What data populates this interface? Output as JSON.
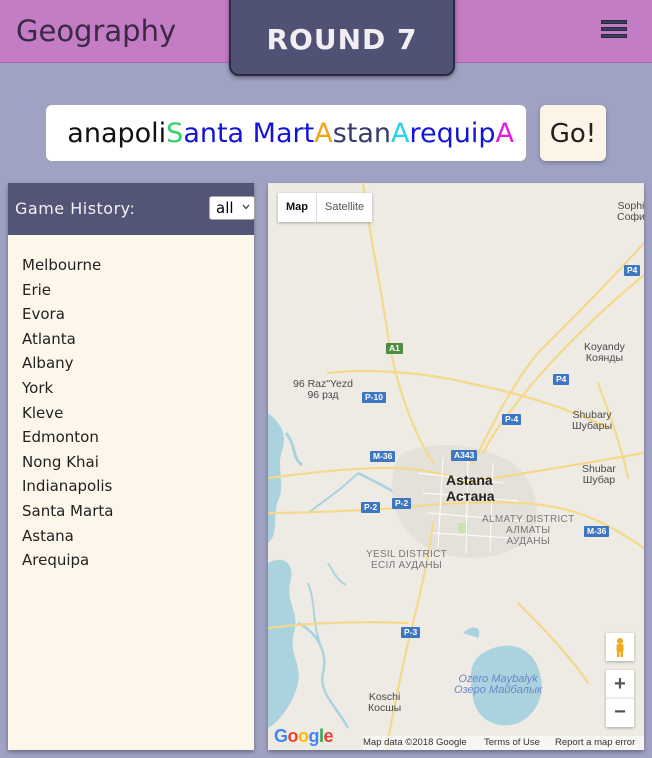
{
  "header": {
    "app_title": "Geography",
    "round_label": "ROUND 7"
  },
  "answer": {
    "segments": [
      {
        "text": "anapoli",
        "color": "#111111"
      },
      {
        "text": "S",
        "color": "#2fd16c"
      },
      {
        "text": "anta Mart",
        "color": "#1414d8"
      },
      {
        "text": "A",
        "color": "#f2a31a"
      },
      {
        "text": "stan",
        "color": "#3a3a6e"
      },
      {
        "text": "A",
        "color": "#27d4e6"
      },
      {
        "text": "requip",
        "color": "#1414d8"
      },
      {
        "text": "A",
        "color": "#e01de0"
      }
    ],
    "go_label": "Go!"
  },
  "history": {
    "title": "Game History:",
    "filter_value": "all",
    "items": [
      "Melbourne",
      "Erie",
      "Evora",
      "Atlanta",
      "Albany",
      "York",
      "Kleve",
      "Edmonton",
      "Nong Khai",
      "Indianapolis",
      "Santa Marta",
      "Astana",
      "Arequipa"
    ]
  },
  "map": {
    "map_button": "Map",
    "satellite_button": "Satellite",
    "zoom_in": "+",
    "zoom_out": "−",
    "google": "Google",
    "attribution": "Map data ©2018 Google",
    "terms": "Terms of Use",
    "report": "Report a map error",
    "labels": {
      "sophi": "Sophi",
      "sophi_cyr": "Софи",
      "raz": "96 Raz\"Yezd",
      "raz_cyr": "96 рзд",
      "koyandy": "Koyandy",
      "koyandy_cyr": "Коянды",
      "shubary": "Shubary",
      "shubary_cyr": "Шубары",
      "shubar": "Shubar",
      "shubar_cyr": "Шубар",
      "astana": "Astana",
      "astana_cyr": "Астана",
      "almaty_d": "ALMATY DISTRICT",
      "almaty_d_cyr": "АЛМАТЫ",
      "almaty_d_cyr2": "АУДАНЫ",
      "yesil_d": "YESIL DISTRICT",
      "yesil_d_cyr": "ЕСІЛ АУДАНЫ",
      "lake": "Ozero Maybalyk",
      "lake_cyr": "Озеро Майбалык",
      "koschi": "Koschi",
      "koschi_cyr": "Косшы"
    },
    "shields": {
      "a1": "A1",
      "p4a": "P4",
      "p4b": "P4",
      "p10": "P-10",
      "p4c": "P-4",
      "m36a": "M-36",
      "a343": "A343",
      "p2a": "P-2",
      "p2b": "P-2",
      "m36b": "M-36",
      "p3": "P-3"
    }
  }
}
